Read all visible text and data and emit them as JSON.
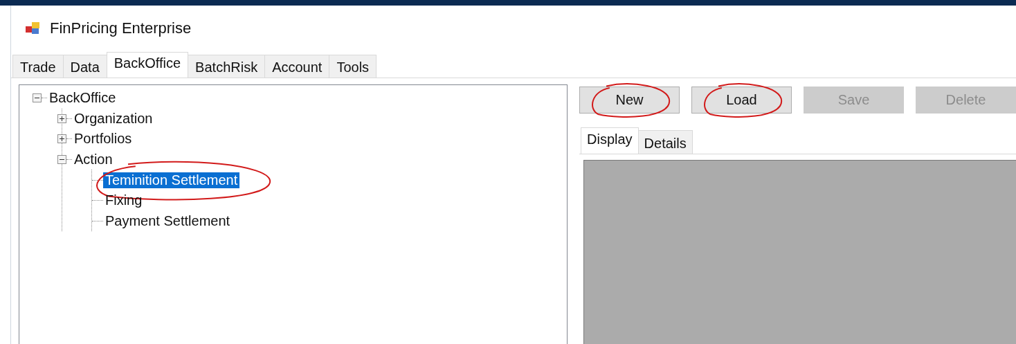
{
  "window": {
    "title": "FinPricing Enterprise"
  },
  "tabs": [
    {
      "label": "Trade",
      "selected": false
    },
    {
      "label": "Data",
      "selected": false
    },
    {
      "label": "BackOffice",
      "selected": true
    },
    {
      "label": "BatchRisk",
      "selected": false
    },
    {
      "label": "Account",
      "selected": false
    },
    {
      "label": "Tools",
      "selected": false
    }
  ],
  "tree": [
    {
      "label": "BackOffice",
      "expanded": true,
      "selected": false,
      "children": [
        {
          "label": "Organization",
          "expanded": false,
          "selected": false
        },
        {
          "label": "Portfolios",
          "expanded": false,
          "selected": false
        },
        {
          "label": "Action",
          "expanded": true,
          "selected": false,
          "children": [
            {
              "label": "Teminition Settlement",
              "selected": true,
              "circled": true
            },
            {
              "label": "Fixing",
              "selected": false,
              "circled": false
            },
            {
              "label": "Payment Settlement",
              "selected": false,
              "circled": false
            }
          ]
        }
      ]
    }
  ],
  "buttons": [
    {
      "label": "New",
      "disabled": false,
      "circled": true
    },
    {
      "label": "Load",
      "disabled": false,
      "circled": true
    },
    {
      "label": "Save",
      "disabled": true,
      "circled": false
    },
    {
      "label": "Delete",
      "disabled": true,
      "circled": false
    }
  ],
  "detail_tabs": [
    {
      "label": "Display",
      "selected": true
    },
    {
      "label": "Details",
      "selected": false
    }
  ]
}
